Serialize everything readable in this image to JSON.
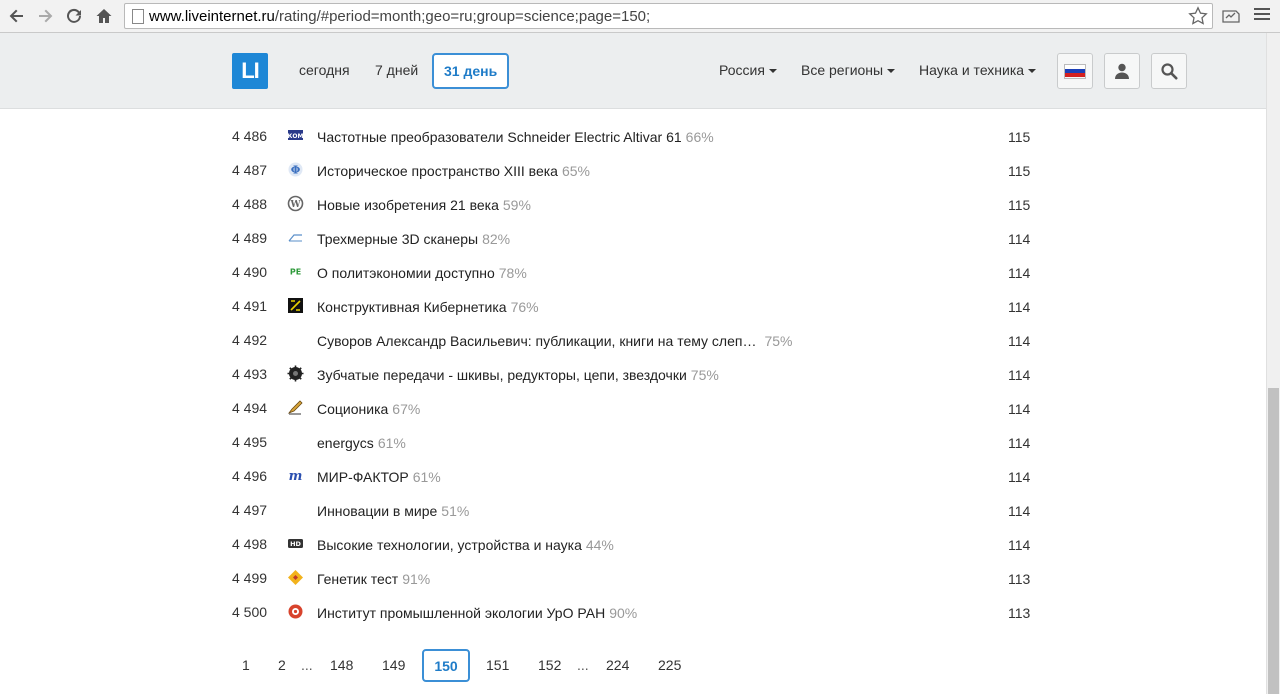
{
  "browser": {
    "url_host": "www.liveinternet.ru",
    "url_path": "/rating/#period=month;geo=ru;group=science;page=150;"
  },
  "header": {
    "logo": "LI",
    "periods": [
      "сегодня",
      "7 дней",
      "31 день"
    ],
    "active_period": "31 день",
    "country": "Россия",
    "region": "Все регионы",
    "category": "Наука и техника"
  },
  "rows": [
    {
      "rank": "4 486",
      "title": "Частотные преобразователи Schneider Electric Altivar 61",
      "pct": "66%",
      "visits": "115",
      "icon": "book-icon"
    },
    {
      "rank": "4 487",
      "title": "Историческое пространство XIII века",
      "pct": "65%",
      "visits": "115",
      "icon": "phi-icon"
    },
    {
      "rank": "4 488",
      "title": "Новые изобретения 21 века",
      "pct": "59%",
      "visits": "115",
      "icon": "wordpress-icon"
    },
    {
      "rank": "4 489",
      "title": "Трехмерные 3D сканеры",
      "pct": "82%",
      "visits": "114",
      "icon": "scanner-icon"
    },
    {
      "rank": "4 490",
      "title": "О политэкономии доступно",
      "pct": "78%",
      "visits": "114",
      "icon": "pe-icon"
    },
    {
      "rank": "4 491",
      "title": "Конструктивная Кибернетика",
      "pct": "76%",
      "visits": "114",
      "icon": "cybernetics-icon"
    },
    {
      "rank": "4 492",
      "title": "Суворов Александр Васильевич: публикации, книги на тему слеп…",
      "pct": "75%",
      "visits": "114",
      "icon": ""
    },
    {
      "rank": "4 493",
      "title": "Зубчатые передачи - шкивы, редукторы, цепи, звездочки",
      "pct": "75%",
      "visits": "114",
      "icon": "gear-icon"
    },
    {
      "rank": "4 494",
      "title": "Соционика",
      "pct": "67%",
      "visits": "114",
      "icon": "pen-icon"
    },
    {
      "rank": "4 495",
      "title": "energycs",
      "pct": "61%",
      "visits": "114",
      "icon": ""
    },
    {
      "rank": "4 496",
      "title": "МИР-ФАКТОР",
      "pct": "61%",
      "visits": "114",
      "icon": "m-icon"
    },
    {
      "rank": "4 497",
      "title": "Инновации в мире",
      "pct": "51%",
      "visits": "114",
      "icon": ""
    },
    {
      "rank": "4 498",
      "title": "Высокие технологии, устройства и наука",
      "pct": "44%",
      "visits": "114",
      "icon": "hd-icon"
    },
    {
      "rank": "4 499",
      "title": "Генетик тест",
      "pct": "91%",
      "visits": "113",
      "icon": "diamond-icon"
    },
    {
      "rank": "4 500",
      "title": "Институт промышленной экологии УрО РАН",
      "pct": "90%",
      "visits": "113",
      "icon": "circle-logo-icon"
    }
  ],
  "pager": [
    "1",
    "2",
    "...",
    "148",
    "149",
    "150",
    "151",
    "152",
    "...",
    "224",
    "225"
  ],
  "pager_active": "150",
  "colors": {
    "accent": "#1f7cc8",
    "logo": "#1e87d6"
  }
}
